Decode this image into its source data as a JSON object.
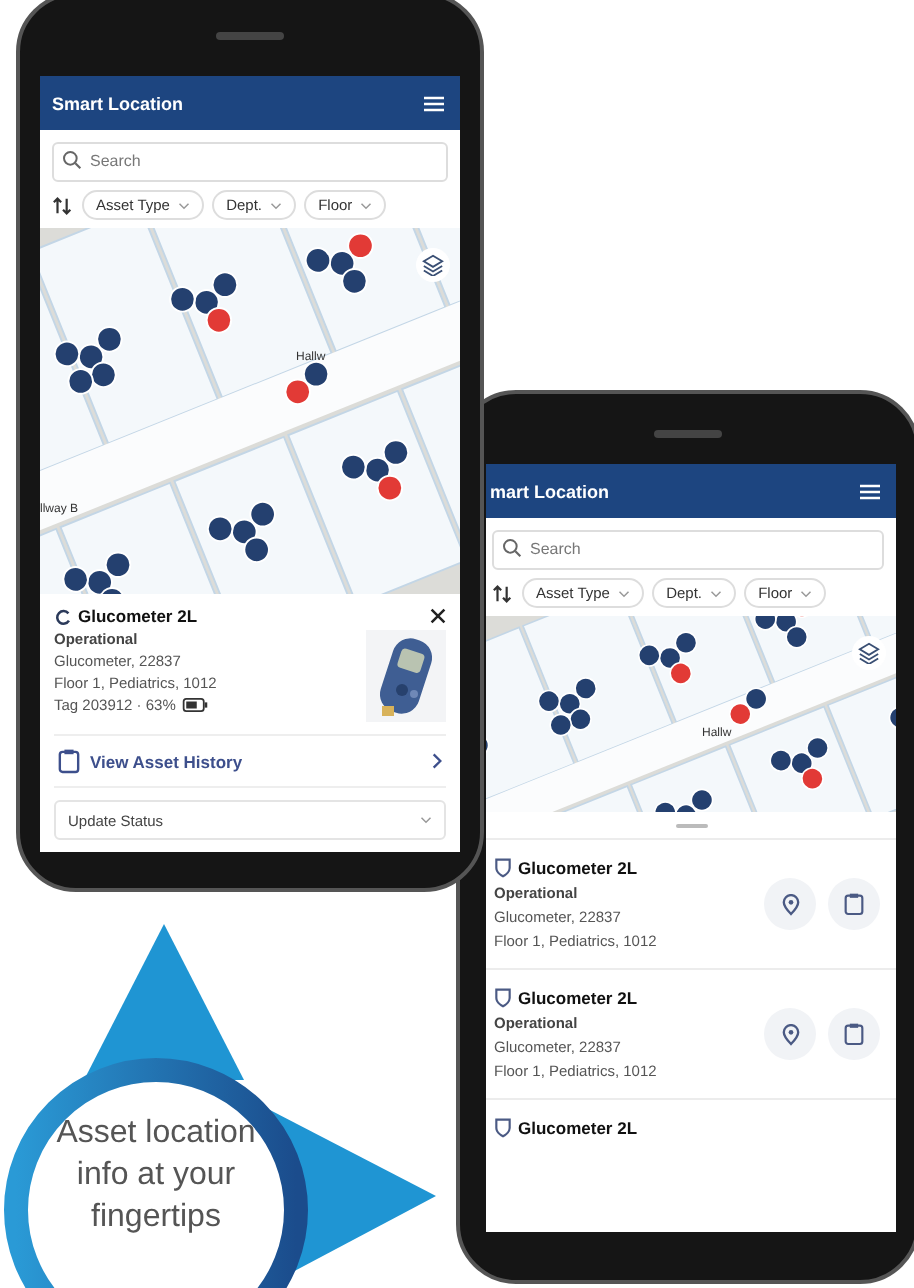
{
  "phones": [
    {
      "kind": "detail",
      "title": "Smart Location",
      "search": {
        "placeholder": "Search"
      },
      "filters": [
        {
          "label": "Asset Type"
        },
        {
          "label": "Dept."
        },
        {
          "label": "Floor"
        }
      ],
      "map_labels": [
        "Hallw",
        "llway B"
      ],
      "asset": {
        "name": "Glucometer 2L",
        "status": "Operational",
        "model": "Glucometer, 22837",
        "location": "Floor 1, Pediatrics, 1012",
        "tag": "Tag 203912 · 63%"
      },
      "history_link": "View Asset History",
      "status_dropdown": {
        "label": "Update Status"
      }
    },
    {
      "kind": "list",
      "title": "mart Location",
      "search": {
        "placeholder": "Search"
      },
      "filters": [
        {
          "label": "Asset Type"
        },
        {
          "label": "Dept."
        },
        {
          "label": "Floor"
        }
      ],
      "map_labels": [
        "Hallw"
      ],
      "assets": [
        {
          "name": "Glucometer 2L",
          "status": "Operational",
          "model": "Glucometer, 22837",
          "location": "Floor 1, Pediatrics, 1012"
        },
        {
          "name": "Glucometer 2L",
          "status": "Operational",
          "model": "Glucometer, 22837",
          "location": "Floor 1, Pediatrics, 1012"
        },
        {
          "name": "Glucometer 2L"
        }
      ]
    }
  ],
  "callout": {
    "text": "Asset location info at your fingertips"
  }
}
